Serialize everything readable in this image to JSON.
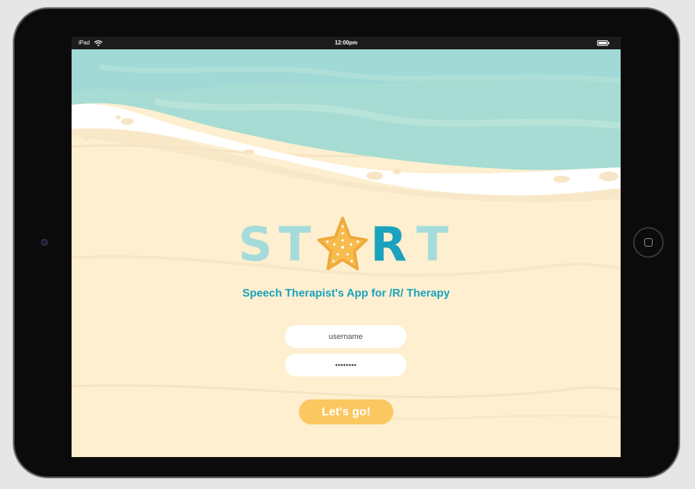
{
  "status_bar": {
    "device_label": "iPad",
    "time": "12:00pm",
    "icons": [
      "wifi-icon",
      "battery-icon"
    ]
  },
  "logo": {
    "letters": [
      "S",
      "T",
      "R",
      "T"
    ],
    "star_icon": "starfish-icon",
    "colors": {
      "light_teal": "#a6dbdb",
      "teal": "#1ba2bf",
      "starfish": "#f7bc4d"
    }
  },
  "subtitle": "Speech Therapist's App for /R/ Therapy",
  "login": {
    "username_placeholder": "username",
    "password_value": "••••••••",
    "submit_label": "Let's go!"
  },
  "theme": {
    "sand": "#fdefcf",
    "sea": "#a6dcd3",
    "foam": "#ffffff",
    "button": "#fbc760"
  }
}
